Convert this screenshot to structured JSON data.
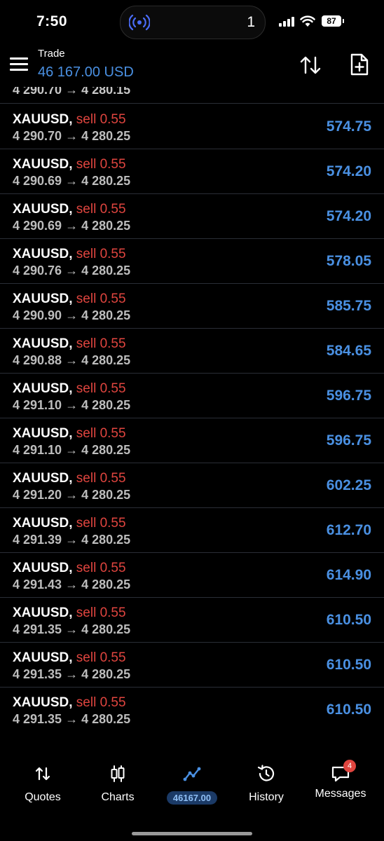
{
  "status_bar": {
    "time": "7:50",
    "island_count": "1",
    "battery": "87"
  },
  "header": {
    "title": "Trade",
    "balance": "46 167.00 USD"
  },
  "partial_row": {
    "prices": "4 290.70 → 4 280.15"
  },
  "positions": [
    {
      "symbol": "XAUUSD,",
      "side": "sell 0.55",
      "prices": "4 290.70 → 4 280.25",
      "profit": "574.75"
    },
    {
      "symbol": "XAUUSD,",
      "side": "sell 0.55",
      "prices": "4 290.69 → 4 280.25",
      "profit": "574.20"
    },
    {
      "symbol": "XAUUSD,",
      "side": "sell 0.55",
      "prices": "4 290.69 → 4 280.25",
      "profit": "574.20"
    },
    {
      "symbol": "XAUUSD,",
      "side": "sell 0.55",
      "prices": "4 290.76 → 4 280.25",
      "profit": "578.05"
    },
    {
      "symbol": "XAUUSD,",
      "side": "sell 0.55",
      "prices": "4 290.90 → 4 280.25",
      "profit": "585.75"
    },
    {
      "symbol": "XAUUSD,",
      "side": "sell 0.55",
      "prices": "4 290.88 → 4 280.25",
      "profit": "584.65"
    },
    {
      "symbol": "XAUUSD,",
      "side": "sell 0.55",
      "prices": "4 291.10 → 4 280.25",
      "profit": "596.75"
    },
    {
      "symbol": "XAUUSD,",
      "side": "sell 0.55",
      "prices": "4 291.10 → 4 280.25",
      "profit": "596.75"
    },
    {
      "symbol": "XAUUSD,",
      "side": "sell 0.55",
      "prices": "4 291.20 → 4 280.25",
      "profit": "602.25"
    },
    {
      "symbol": "XAUUSD,",
      "side": "sell 0.55",
      "prices": "4 291.39 → 4 280.25",
      "profit": "612.70"
    },
    {
      "symbol": "XAUUSD,",
      "side": "sell 0.55",
      "prices": "4 291.43 → 4 280.25",
      "profit": "614.90"
    },
    {
      "symbol": "XAUUSD,",
      "side": "sell 0.55",
      "prices": "4 291.35 → 4 280.25",
      "profit": "610.50"
    },
    {
      "symbol": "XAUUSD,",
      "side": "sell 0.55",
      "prices": "4 291.35 → 4 280.25",
      "profit": "610.50"
    },
    {
      "symbol": "XAUUSD,",
      "side": "sell 0.55",
      "prices": "4 291.35 → 4 280.25",
      "profit": "610.50"
    }
  ],
  "nav": {
    "quotes": "Quotes",
    "charts": "Charts",
    "trade_balance": "46167.00",
    "history": "History",
    "messages": "Messages",
    "messages_badge": "4"
  },
  "colors": {
    "accent_blue": "#4a90e2",
    "sell_red": "#e0453f",
    "background": "#000000"
  }
}
